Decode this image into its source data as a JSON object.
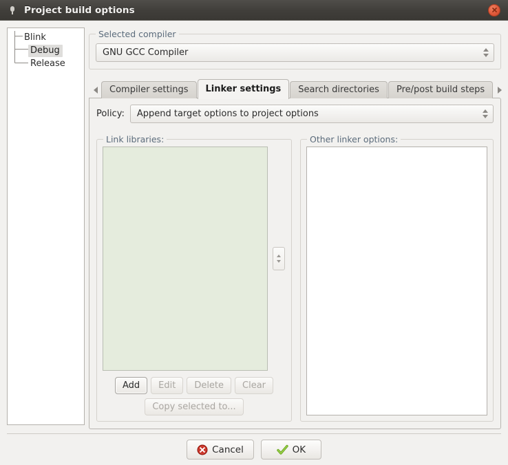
{
  "window": {
    "title": "Project build options",
    "icon": "microphone-icon",
    "close_label": "×",
    "accent_close": "#e0593a"
  },
  "tree": {
    "items": [
      {
        "label": "Blink",
        "level": 0,
        "selected": false
      },
      {
        "label": "Debug",
        "level": 1,
        "selected": true
      },
      {
        "label": "Release",
        "level": 1,
        "selected": false
      }
    ]
  },
  "compiler_group": {
    "title": "Selected compiler",
    "combo_value": "GNU GCC Compiler"
  },
  "tabs": {
    "scroll_left": "◀",
    "scroll_right": "▶",
    "items": [
      {
        "label": "Compiler settings",
        "active": false
      },
      {
        "label": "Linker settings",
        "active": true
      },
      {
        "label": "Search directories",
        "active": false
      },
      {
        "label": "Pre/post build steps",
        "active": false
      }
    ]
  },
  "policy": {
    "label": "Policy:",
    "value": "Append target options to project options"
  },
  "link_libraries": {
    "title": "Link libraries:",
    "items": [],
    "list_bg": "#e5ecdd",
    "buttons": [
      {
        "label": "Add",
        "enabled": true
      },
      {
        "label": "Edit",
        "enabled": false
      },
      {
        "label": "Delete",
        "enabled": false
      },
      {
        "label": "Clear",
        "enabled": false
      }
    ],
    "copy_button": {
      "label": "Copy selected to...",
      "enabled": false
    }
  },
  "other_linker_options": {
    "title": "Other linker options:",
    "value": ""
  },
  "footer": {
    "cancel_label": "Cancel",
    "ok_label": "OK",
    "cancel_icon": "error-circle-icon",
    "ok_icon": "checkmark-icon"
  }
}
